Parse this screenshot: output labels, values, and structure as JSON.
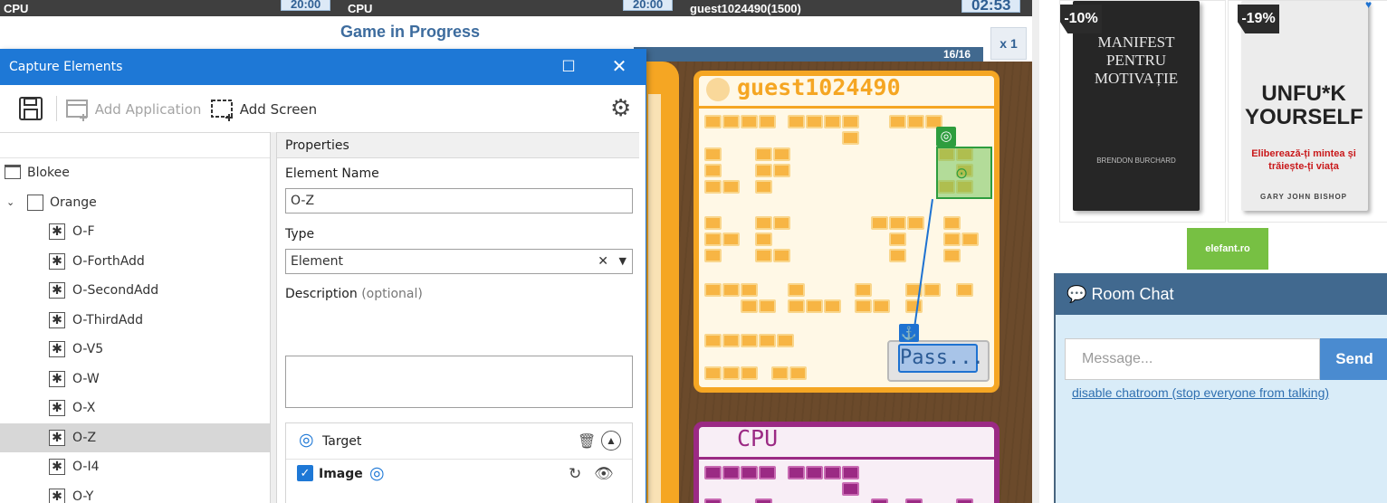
{
  "game": {
    "strip": {
      "player1_name": "CPU",
      "player1_time": "20:00",
      "player2_name": "CPU",
      "player2_time": "20:00",
      "player3_name": "guest1024490(1500)",
      "player3_time": "02:53"
    },
    "title": "Game in Progress",
    "multiplier": "x 1",
    "round": "16/16",
    "player_board_name": "guest1024490",
    "pass_button": "Pass...",
    "cpu_board_name": "CPU",
    "colors": {
      "orange": "#f5a623",
      "purple": "#9b2a84",
      "capture_green": "#2e9d3e",
      "anchor_blue": "#1e72d1"
    }
  },
  "ads": {
    "book1": {
      "discount": "-10%",
      "title": "MANIFEST PENTRU MOTIVAȚIE",
      "author": "BRENDON BURCHARD"
    },
    "book2": {
      "discount": "-19%",
      "title": "UNFU*K YOURSELF",
      "subtitle": "Eliberează-ți mintea și trăiește-ți viața",
      "author": "GARY JOHN BISHOP"
    },
    "shop": "elefant.ro"
  },
  "chat": {
    "header": "Room Chat",
    "header_icon": "comments-icon",
    "placeholder": "Message...",
    "send": "Send",
    "link": "disable chatroom (stop everyone from talking)"
  },
  "dialog": {
    "title": "Capture Elements",
    "maximize_icon": "maximize-icon",
    "close_icon": "close-icon",
    "toolbar": {
      "save_icon": "save-icon",
      "add_application": "Add Application",
      "add_screen": "Add Screen",
      "settings_icon": "gear-icon"
    },
    "tree": {
      "items": [
        {
          "label": "Blokee",
          "level": 0,
          "kind": "app"
        },
        {
          "label": "Orange",
          "level": 0,
          "kind": "screen",
          "expanded": true
        },
        {
          "label": "O-F",
          "level": 1,
          "kind": "element"
        },
        {
          "label": "O-ForthAdd",
          "level": 1,
          "kind": "element"
        },
        {
          "label": "O-SecondAdd",
          "level": 1,
          "kind": "element"
        },
        {
          "label": "O-ThirdAdd",
          "level": 1,
          "kind": "element"
        },
        {
          "label": "O-V5",
          "level": 1,
          "kind": "element"
        },
        {
          "label": "O-W",
          "level": 1,
          "kind": "element"
        },
        {
          "label": "O-X",
          "level": 1,
          "kind": "element"
        },
        {
          "label": "O-Z",
          "level": 1,
          "kind": "element",
          "selected": true
        },
        {
          "label": "O-I4",
          "level": 1,
          "kind": "element"
        },
        {
          "label": "O-Y",
          "level": 1,
          "kind": "element"
        }
      ]
    },
    "properties": {
      "header": "Properties",
      "element_name_label": "Element Name",
      "element_name_value": "O-Z",
      "type_label": "Type",
      "type_value": "Element",
      "description_label": "Description",
      "description_optional": "(optional)",
      "description_value": "",
      "target_label": "Target",
      "image_label": "Image",
      "image_checked": true
    }
  }
}
